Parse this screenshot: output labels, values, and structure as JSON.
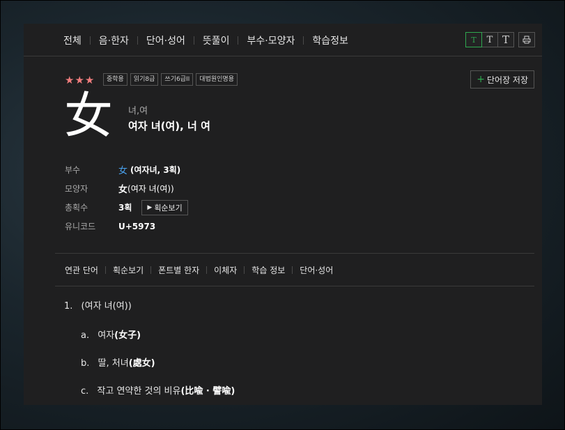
{
  "topnav": {
    "tabs": [
      "전체",
      "음·한자",
      "단어·성어",
      "뜻풀이",
      "부수·모양자",
      "학습정보"
    ],
    "font_buttons": [
      "T",
      "T",
      "T"
    ],
    "print_icon": "printer-icon"
  },
  "header": {
    "stars": "★★★",
    "badges": [
      "중학용",
      "읽기8급",
      "쓰기6급II",
      "대법원인명용"
    ],
    "save_label": "단어장 저장",
    "save_icon": "+"
  },
  "character": {
    "glyph": "女",
    "reading": "녀,여",
    "meaning": "여자 녀(여), 너 여"
  },
  "info": {
    "radical_label": "부수",
    "radical_char": "女",
    "radical_detail": "(여자녀, 3획)",
    "shape_label": "모양자",
    "shape_char": "女",
    "shape_detail": "(여자 녀(여))",
    "strokes_label": "총획수",
    "strokes_value": "3획",
    "stroke_order_label": "획순보기",
    "unicode_label": "유니코드",
    "unicode_value": "U+5973"
  },
  "subtabs": [
    "연관 단어",
    "획순보기",
    "폰트별 한자",
    "이체자",
    "학습 정보",
    "단어·성어"
  ],
  "definitions": {
    "main_num": "1.",
    "main_text": "(여자 녀(여))",
    "subs": [
      {
        "letter": "a.",
        "text": "여자",
        "hanja": "(女子)"
      },
      {
        "letter": "b.",
        "text": "딸, 처녀",
        "hanja": "(處女)"
      },
      {
        "letter": "c.",
        "text": "작고 연약한 것의 비유",
        "hanja": "(比喩 · 譬喩)"
      }
    ]
  },
  "colors": {
    "accent": "#2fa84f",
    "star": "#ef7d7d",
    "link": "#4aa3f0",
    "panel": "#1f1f20"
  }
}
